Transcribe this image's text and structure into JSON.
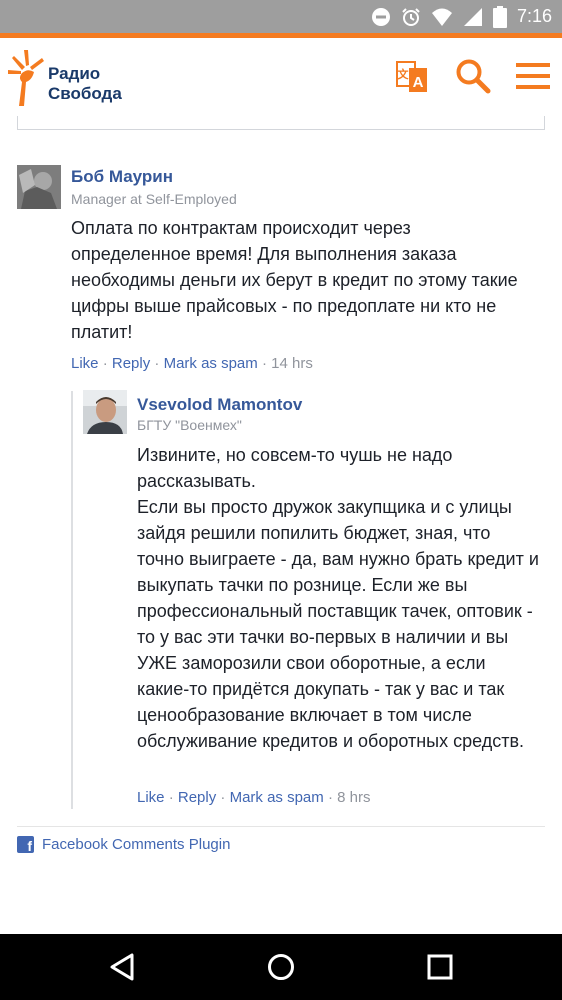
{
  "status_bar": {
    "time": "7:16",
    "battery_level": "94",
    "icons": [
      "do-not-disturb-icon",
      "alarm-icon",
      "wifi-icon",
      "signal-icon",
      "battery-icon"
    ]
  },
  "header": {
    "logo_line1": "Радио",
    "logo_line2": "Свобода",
    "brand_color": "#f47b20",
    "icons": [
      "translate-icon",
      "search-icon",
      "menu-icon"
    ]
  },
  "comments": [
    {
      "author": "Боб Маурин",
      "subtitle": "Manager at Self-Employed",
      "body": "Оплата по контрактам происходит через определенное время! Для выполнения заказа необходимы деньги их берут в кредит по этому такие цифры выше прайсовых - по предоплате ни кто не платит!",
      "actions": {
        "like": "Like",
        "reply": "Reply",
        "spam": "Mark as spam",
        "sep": "·",
        "time": "14 hrs"
      }
    },
    {
      "author": "Vsevolod Mamontov",
      "subtitle": "БГТУ \"Военмех\"",
      "body_lines": [
        "Извините, но совсем-то чушь не надо рассказывать.",
        "Если вы просто дружок закупщика и с улицы зайдя решили попилить бюджет, зная, что точно выиграете - да, вам нужно брать кредит и выкупать тачки по рознице. Если же вы профессиональный поставщик тачек, оптовик - то у вас эти тачки во-первых в наличии и вы УЖЕ заморозили свои оборотные, а если какие-то придётся докупать - так у вас и так ценообразование включает в том числе обслуживание кредитов и оборотных средств."
      ],
      "actions": {
        "like": "Like",
        "reply": "Reply",
        "spam": "Mark as spam",
        "sep": "·",
        "time": "8 hrs"
      }
    }
  ],
  "footer": {
    "plugin_label": "Facebook Comments Plugin",
    "plugin_icon_letter": "f"
  },
  "nav_bar": {
    "buttons": [
      "back-icon",
      "home-icon",
      "recents-icon"
    ]
  }
}
